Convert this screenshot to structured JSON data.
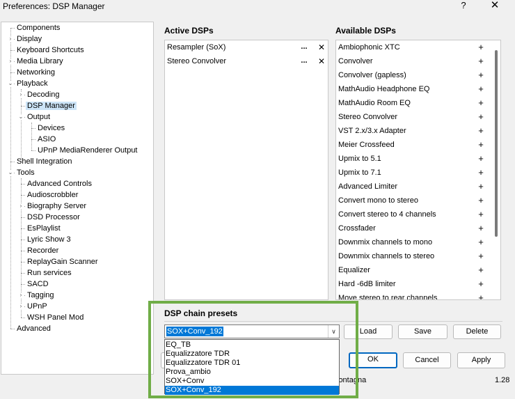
{
  "window": {
    "title": "Preferences: DSP Manager",
    "help_label": "?",
    "close_label": "✕"
  },
  "tree": {
    "items": [
      {
        "label": "Components"
      },
      {
        "label": "Display"
      },
      {
        "label": "Keyboard Shortcuts"
      },
      {
        "label": "Media Library"
      },
      {
        "label": "Networking"
      },
      {
        "label": "Playback"
      },
      {
        "label": "Decoding"
      },
      {
        "label": "DSP Manager"
      },
      {
        "label": "Output"
      },
      {
        "label": "Devices"
      },
      {
        "label": "ASIO"
      },
      {
        "label": "UPnP MediaRenderer Output"
      },
      {
        "label": "Shell Integration"
      },
      {
        "label": "Tools"
      },
      {
        "label": "Advanced Controls"
      },
      {
        "label": "Audioscrobbler"
      },
      {
        "label": "Biography Server"
      },
      {
        "label": "DSD Processor"
      },
      {
        "label": "EsPlaylist"
      },
      {
        "label": "Lyric Show 3"
      },
      {
        "label": "Recorder"
      },
      {
        "label": "ReplayGain Scanner"
      },
      {
        "label": "Run services"
      },
      {
        "label": "SACD"
      },
      {
        "label": "Tagging"
      },
      {
        "label": "UPnP"
      },
      {
        "label": "WSH Panel Mod"
      },
      {
        "label": "Advanced"
      }
    ],
    "selected": "DSP Manager"
  },
  "active_dsps": {
    "heading": "Active DSPs",
    "config_label": "...",
    "remove_label": "✕",
    "items": [
      {
        "label": "Resampler (SoX)"
      },
      {
        "label": "Stereo Convolver"
      }
    ]
  },
  "available_dsps": {
    "heading": "Available DSPs",
    "add_label": "+",
    "items": [
      {
        "label": "Ambiophonic XTC"
      },
      {
        "label": "Convolver"
      },
      {
        "label": "Convolver (gapless)"
      },
      {
        "label": "MathAudio Headphone EQ"
      },
      {
        "label": "MathAudio Room EQ"
      },
      {
        "label": "Stereo Convolver"
      },
      {
        "label": "VST 2.x/3.x Adapter"
      },
      {
        "label": "Meier Crossfeed"
      },
      {
        "label": "Upmix to 5.1"
      },
      {
        "label": "Upmix to 7.1"
      },
      {
        "label": "Advanced Limiter"
      },
      {
        "label": "Convert mono to stereo"
      },
      {
        "label": "Convert stereo to 4 channels"
      },
      {
        "label": "Crossfader"
      },
      {
        "label": "Downmix channels to mono"
      },
      {
        "label": "Downmix channels to stereo"
      },
      {
        "label": "Equalizer"
      },
      {
        "label": "Hard -6dB limiter"
      },
      {
        "label": "Move stereo to rear channels"
      }
    ]
  },
  "presets": {
    "heading": "DSP chain presets",
    "current": "SOX+Conv_192",
    "arrow": "∨",
    "load_label": "Load",
    "save_label": "Save",
    "delete_label": "Delete",
    "options": [
      "EQ_TB",
      "Equalizzatore TDR",
      "Equalizzatore TDR 01",
      "Prova_ambio",
      "SOX+Conv",
      "SOX+Conv_192"
    ],
    "selected_option": "SOX+Conv_192"
  },
  "dialog_buttons": {
    "ok_label": "OK",
    "cancel_label": "Cancel",
    "apply_label": "Apply"
  },
  "status": {
    "text": "lontagna",
    "version": "1.28"
  },
  "colors": {
    "selection": "#0078d7",
    "highlight_frame": "#70ad47",
    "tree_selection": "#cce4f7",
    "primary_border": "#0067c0"
  }
}
